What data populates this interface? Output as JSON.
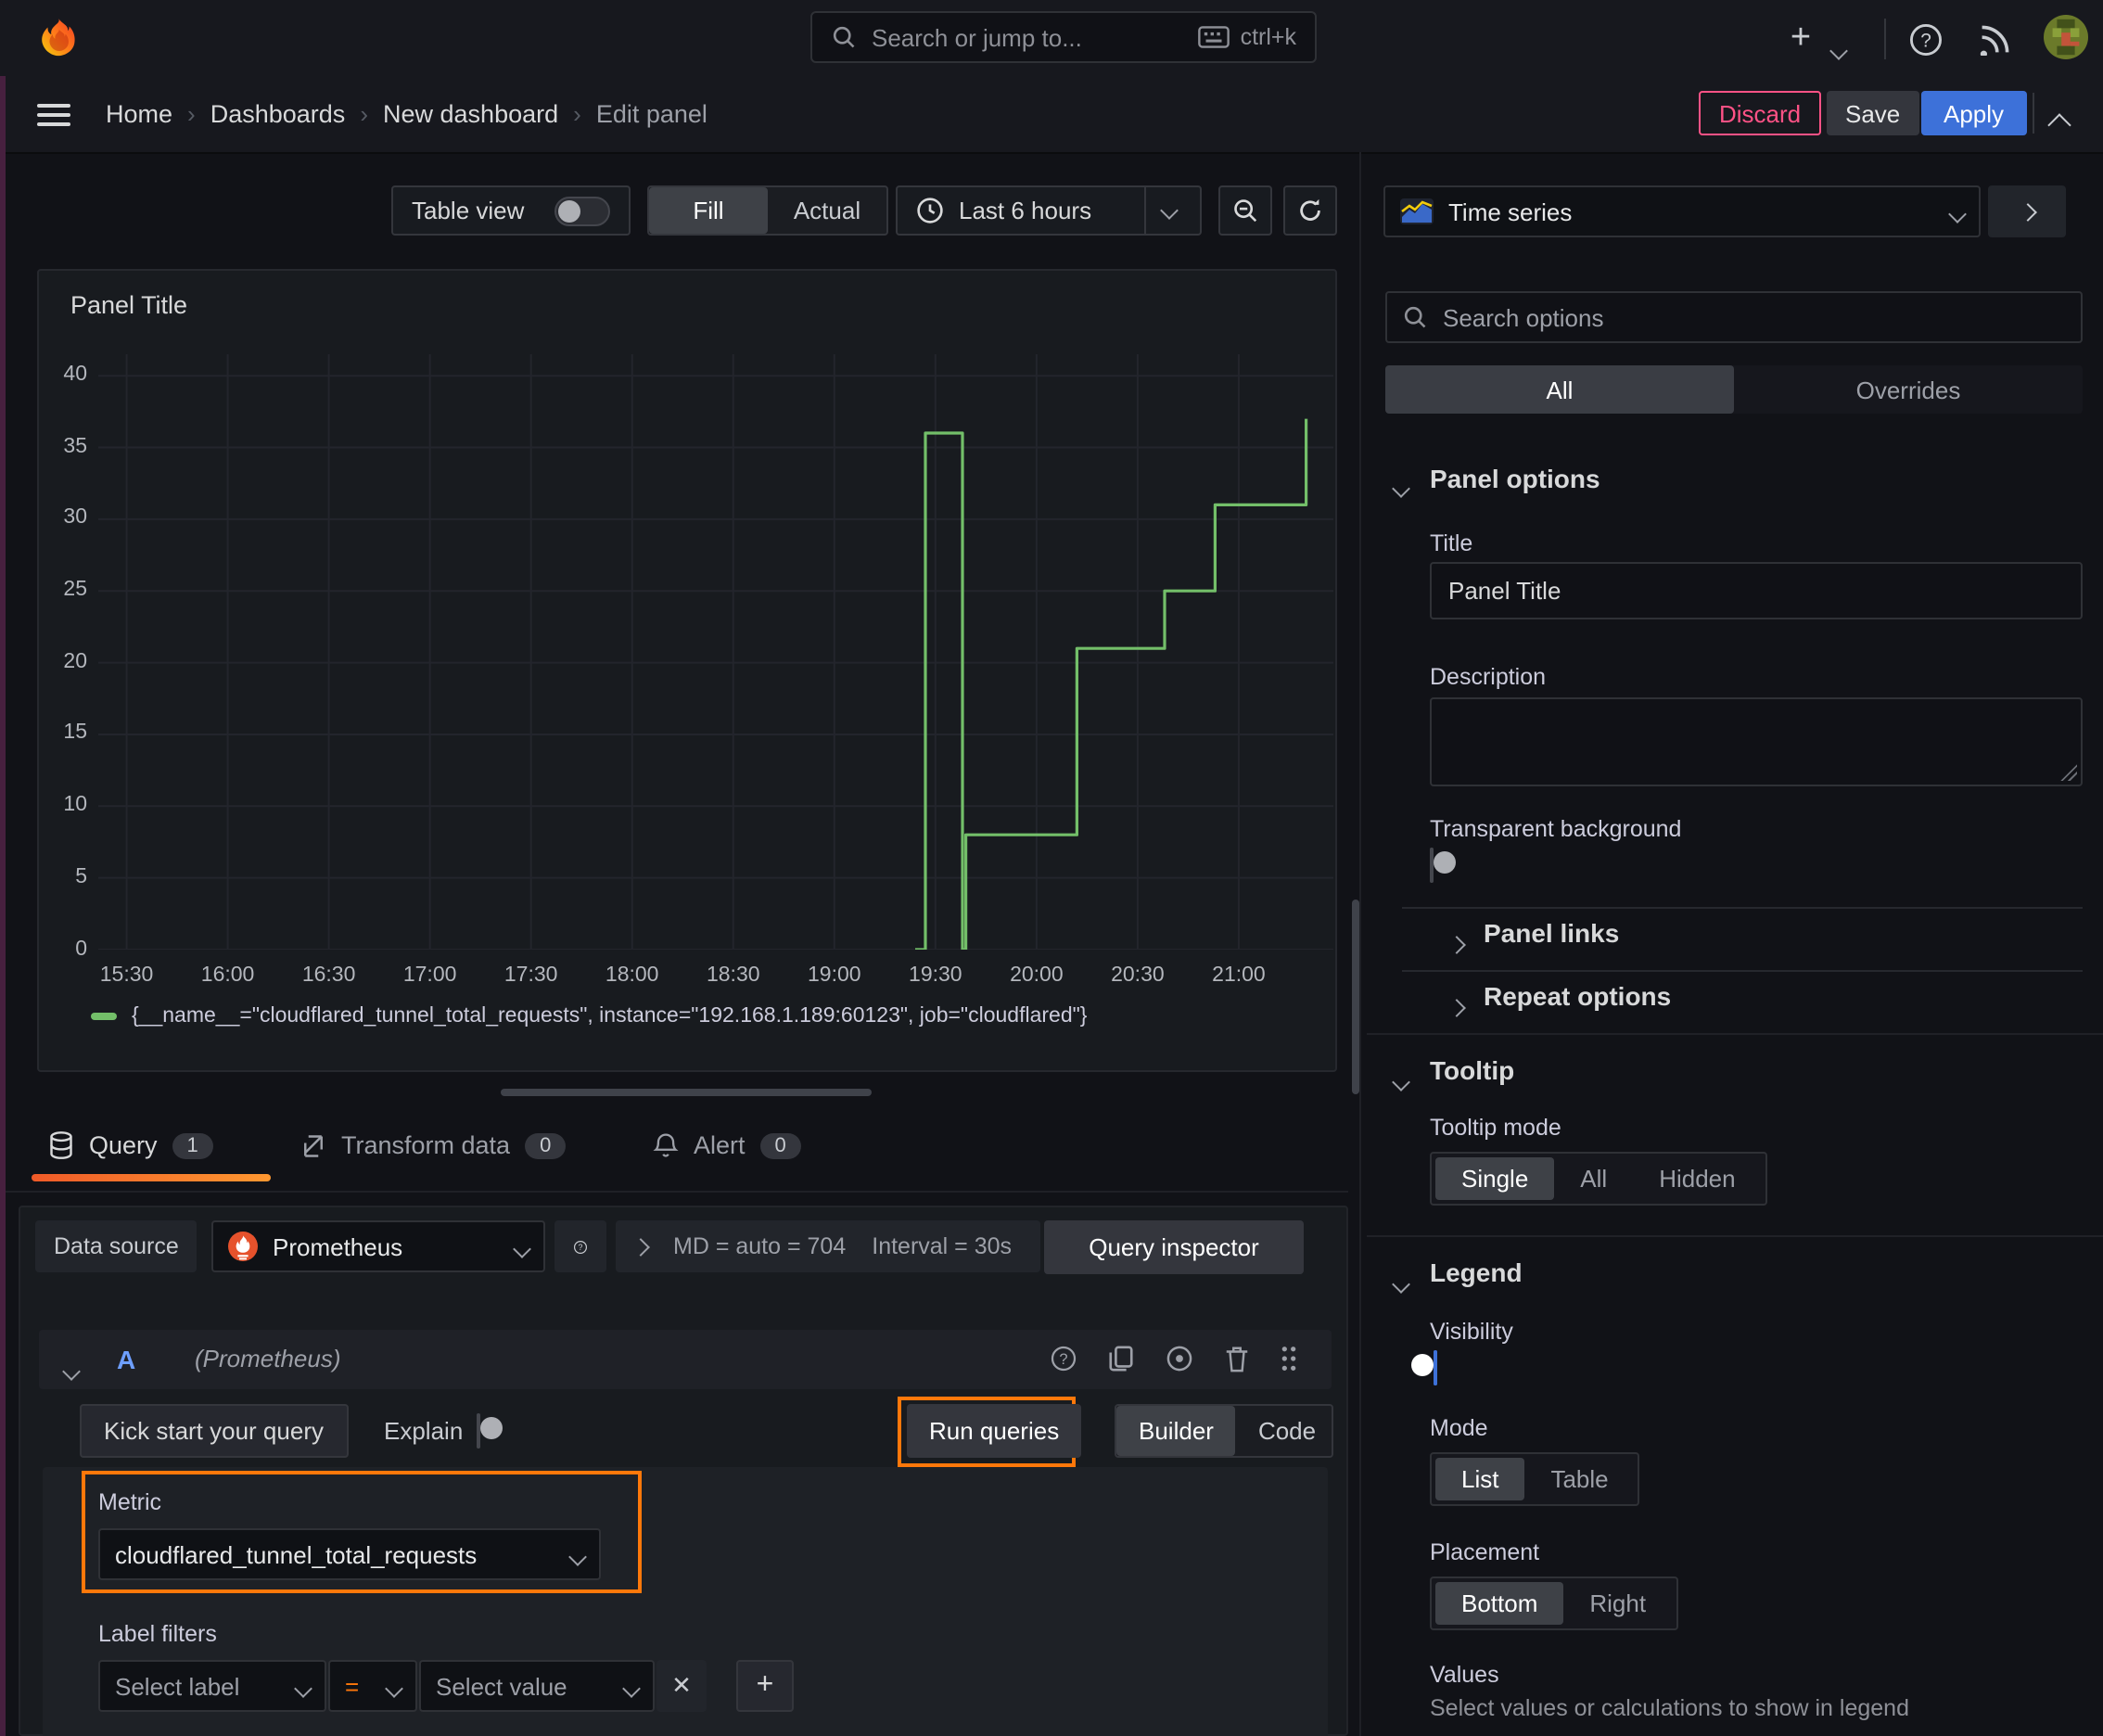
{
  "topbar": {
    "search_placeholder": "Search or jump to...",
    "shortcut": "ctrl+k"
  },
  "breadcrumb": [
    "Home",
    "Dashboards",
    "New dashboard",
    "Edit panel"
  ],
  "actions": {
    "discard": "Discard",
    "save": "Save",
    "apply": "Apply"
  },
  "toolbar": {
    "table_view": "Table view",
    "fill": "Fill",
    "actual": "Actual",
    "time_range": "Last 6 hours"
  },
  "panel": {
    "title": "Panel Title"
  },
  "chart_data": {
    "type": "line",
    "title": "Panel Title",
    "step": true,
    "grid": true,
    "legend_position": "bottom",
    "xlim_hours": [
      15.36,
      21.468
    ],
    "ylim": [
      0,
      41.5
    ],
    "y_ticks": [
      0,
      5,
      10,
      15,
      20,
      25,
      30,
      35,
      40
    ],
    "x_ticks": [
      {
        "h": 15.5,
        "label": "15:30"
      },
      {
        "h": 16.0,
        "label": "16:00"
      },
      {
        "h": 16.5,
        "label": "16:30"
      },
      {
        "h": 17.0,
        "label": "17:00"
      },
      {
        "h": 17.5,
        "label": "17:30"
      },
      {
        "h": 18.0,
        "label": "18:00"
      },
      {
        "h": 18.5,
        "label": "18:30"
      },
      {
        "h": 19.0,
        "label": "19:00"
      },
      {
        "h": 19.5,
        "label": "19:30"
      },
      {
        "h": 20.0,
        "label": "20:00"
      },
      {
        "h": 20.5,
        "label": "20:30"
      },
      {
        "h": 21.0,
        "label": "21:00"
      }
    ],
    "x_grid_extra": [
      21.5
    ],
    "series": [
      {
        "name": "{__name__=\"cloudflared_tunnel_total_requests\", instance=\"192.168.1.189:60123\", job=\"cloudflared\"}",
        "color": "#73bf69",
        "points": [
          {
            "time": "19:24",
            "value": 0
          },
          {
            "time": "19:27",
            "value": 36
          },
          {
            "time": "19:38",
            "value": 0
          },
          {
            "time": "19:39",
            "value": 8
          },
          {
            "time": "20:12",
            "value": 21
          },
          {
            "time": "20:38",
            "value": 25
          },
          {
            "time": "20:53",
            "value": 31
          },
          {
            "time": "21:20",
            "value": 37
          }
        ]
      }
    ]
  },
  "query": {
    "tabs": [
      {
        "label": "Query",
        "badge": "1"
      },
      {
        "label": "Transform data",
        "badge": "0"
      },
      {
        "label": "Alert",
        "badge": "0"
      }
    ],
    "datasource_label": "Data source",
    "datasource": "Prometheus",
    "stats": "MD = auto = 704",
    "interval": "Interval = 30s",
    "inspector": "Query inspector",
    "ref_id": "A",
    "ref_hint": "(Prometheus)",
    "kickstart": "Kick start your query",
    "explain": "Explain",
    "run": "Run queries",
    "builder": "Builder",
    "code": "Code",
    "metric_label": "Metric",
    "metric": "cloudflared_tunnel_total_requests",
    "label_filters": "Label filters",
    "select_label": "Select label",
    "op": "=",
    "select_value": "Select value"
  },
  "options": {
    "viz": "Time series",
    "search_placeholder": "Search options",
    "tab_all": "All",
    "tab_overrides": "Overrides",
    "panel_options": "Panel options",
    "title_label": "Title",
    "title_value": "Panel Title",
    "description_label": "Description",
    "transparent": "Transparent background",
    "panel_links": "Panel links",
    "repeat_options": "Repeat options",
    "tooltip": "Tooltip",
    "tooltip_mode": "Tooltip mode",
    "tooltip_modes": [
      "Single",
      "All",
      "Hidden"
    ],
    "legend": "Legend",
    "visibility": "Visibility",
    "mode": "Mode",
    "legend_modes": [
      "List",
      "Table"
    ],
    "placement": "Placement",
    "placements": [
      "Bottom",
      "Right"
    ],
    "values": "Values",
    "values_help": "Select values or calculations to show in legend"
  },
  "colors": {
    "accent_orange": "#ff780a",
    "series_green": "#73bf69",
    "apply_blue": "#3d71d9",
    "discard_pink": "#ff5286"
  }
}
